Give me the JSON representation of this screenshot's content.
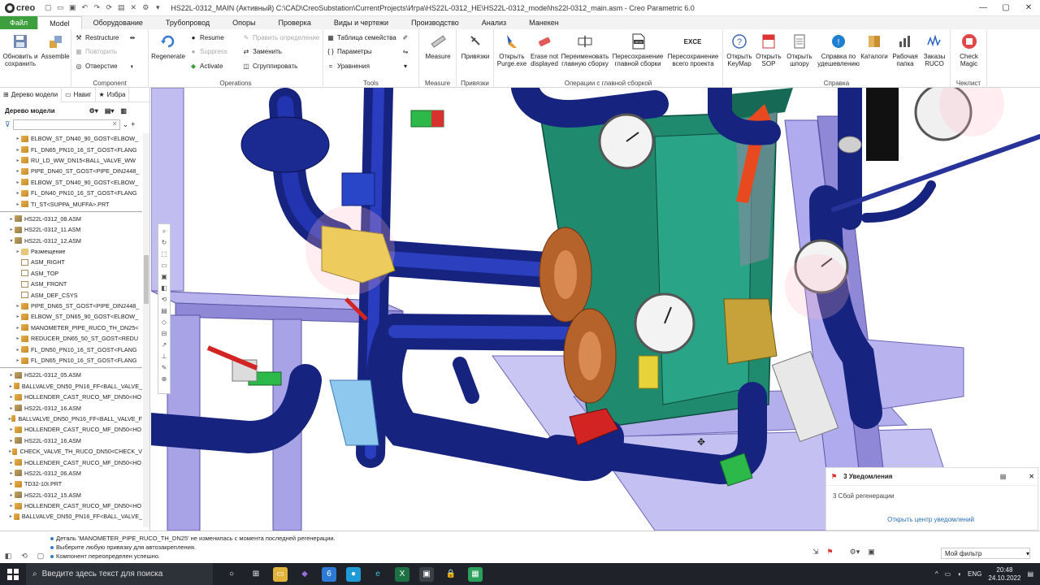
{
  "titlebar": {
    "app_logo": "creo",
    "title": "HS22L-0312_MAIN (Активный) C:\\CAD\\CreoSubstation\\CurrentProjects\\Игра\\HS22L-0312_HE\\HS22L-0312_model\\hs22l-0312_main.asm - Creo Parametric 6.0"
  },
  "menu": {
    "tabs": [
      "Файл",
      "Model",
      "Оборудование",
      "Трубопровод",
      "Опоры",
      "Проверка",
      "Виды и чертежи",
      "Производство",
      "Анализ",
      "Манекен"
    ],
    "active": "Model"
  },
  "ribbon": {
    "g1": {
      "btn1": "Обновить и сохранить",
      "btn2": "Assemble"
    },
    "component": {
      "label": "Component",
      "restructure": "Restructure",
      "repeat": "Повторить",
      "hole": "Отверстие"
    },
    "operations": {
      "label": "Operations",
      "regenerate": "Regenerate",
      "resume": "Resume",
      "suppress": "Suppress",
      "activate": "Activate",
      "edit_def": "Править определение",
      "replace": "Заменить",
      "group": "Сгруппировать"
    },
    "tools": {
      "label": "Tools",
      "family_table": "Таблица семейства",
      "parameters": "Параметры",
      "relations": "Уравнения"
    },
    "measure": {
      "label": "Measure",
      "btn": "Measure"
    },
    "snaps": {
      "label": "Привязки",
      "btn": "Привязки"
    },
    "main_asm_ops": {
      "label": "Операции с главной сборкой",
      "btns": [
        "Открыть Purge.exe",
        "Erase not displayed",
        "Переименовать главную сборку",
        "Пересохранение главной сборки",
        "Пересохранение всего проекта"
      ]
    },
    "help": {
      "label": "Справка",
      "btns": [
        "Открыть KeyMap",
        "Открыть SOP",
        "Открыть шпору",
        "Справка по удешевлению",
        "Каталоги",
        "Рабочая папка",
        "Заказы RUCO"
      ]
    },
    "checklist": {
      "label": "Чеклист",
      "btn": "Check Magic"
    }
  },
  "panel": {
    "tabs": [
      "Дерево модели",
      "Навиг",
      "Избра"
    ],
    "tree_title": "Дерево модели",
    "tree_items": [
      {
        "t": "ELBOW_ST_DN40_90_GOST<ELBOW_",
        "k": "part",
        "ind": 2
      },
      {
        "t": "FL_DN65_PN10_16_ST_GOST<FLANG",
        "k": "part",
        "ind": 2
      },
      {
        "t": "RU_LD_WW_DN15<BALL_VALVE_WW",
        "k": "part",
        "ind": 2
      },
      {
        "t": "PIPE_DN40_ST_GOST<PIPE_DIN2448_",
        "k": "part",
        "ind": 2
      },
      {
        "t": "ELBOW_ST_DN40_90_GOST<ELBOW_",
        "k": "part",
        "ind": 2
      },
      {
        "t": "FL_DN40_PN10_16_ST_GOST<FLANG",
        "k": "part",
        "ind": 2
      },
      {
        "t": "TI_ST<SUPPA_MUFFA>.PRT",
        "k": "part",
        "ind": 2
      },
      {
        "t": "HS22L-0312_08.ASM",
        "k": "asm",
        "ind": 1,
        "sep": true
      },
      {
        "t": "HS22L-0312_11.ASM",
        "k": "asm",
        "ind": 1
      },
      {
        "t": "HS22L-0312_12.ASM",
        "k": "asm",
        "ind": 1,
        "open": true
      },
      {
        "t": "Размещение",
        "k": "folder",
        "ind": 2
      },
      {
        "t": "ASM_RIGHT",
        "k": "datum",
        "ind": 2
      },
      {
        "t": "ASM_TOP",
        "k": "datum",
        "ind": 2
      },
      {
        "t": "ASM_FRONT",
        "k": "datum",
        "ind": 2
      },
      {
        "t": "ASM_DEF_CSYS",
        "k": "datum",
        "ind": 2
      },
      {
        "t": "PIPE_DN65_ST_GOST<PIPE_DIN2448_",
        "k": "part",
        "ind": 2
      },
      {
        "t": "ELBOW_ST_DN65_90_GOST<ELBOW_",
        "k": "part",
        "ind": 2
      },
      {
        "t": "MANOMETER_PIPE_RUCO_TH_DN25<",
        "k": "part",
        "ind": 2
      },
      {
        "t": "REDUCER_DN65_50_ST_GOST<REDU",
        "k": "part",
        "ind": 2
      },
      {
        "t": "FL_DN50_PN10_16_ST_GOST<FLANG",
        "k": "part",
        "ind": 2
      },
      {
        "t": "FL_DN65_PN10_16_ST_GOST<FLANG",
        "k": "part",
        "ind": 2
      },
      {
        "t": "HS22L-0312_05.ASM",
        "k": "asm",
        "ind": 1,
        "sep": true
      },
      {
        "t": "BALLVALVE_DN50_PN16_FF<BALL_VALVE_",
        "k": "part",
        "ind": 1
      },
      {
        "t": "HOLLENDER_CAST_RUCO_MF_DN50<HO",
        "k": "part",
        "ind": 1
      },
      {
        "t": "HS22L-0312_16.ASM",
        "k": "asm",
        "ind": 1
      },
      {
        "t": "BALLVALVE_DN50_PN16_FF<BALL_VALVE_F",
        "k": "part",
        "ind": 1
      },
      {
        "t": "HOLLENDER_CAST_RUCO_MF_DN50<HO",
        "k": "part",
        "ind": 1
      },
      {
        "t": "HS22L-0312_16.ASM",
        "k": "asm",
        "ind": 1
      },
      {
        "t": "CHECK_VALVE_TH_RUCO_DN50<CHECK_V",
        "k": "part",
        "ind": 1
      },
      {
        "t": "HOLLENDER_CAST_RUCO_MF_DN50<HO",
        "k": "part",
        "ind": 1
      },
      {
        "t": "HS22L-0312_06.ASM",
        "k": "asm",
        "ind": 1
      },
      {
        "t": "TD32-10I.PRT",
        "k": "part",
        "ind": 1
      },
      {
        "t": "HS22L-0312_15.ASM",
        "k": "asm",
        "ind": 1
      },
      {
        "t": "HOLLENDER_CAST_RUCO_MF_DN50<HO",
        "k": "part",
        "ind": 1
      },
      {
        "t": "BALLVALVE_DN50_PN16_FF<BALL_VALVE_",
        "k": "part",
        "ind": 1
      }
    ]
  },
  "notification": {
    "title": "3 Уведомления",
    "body": "3 Сбой регенерации",
    "link": "Открыть центр уведомлений"
  },
  "status": {
    "messages": [
      "Деталь 'MANOMETER_PIPE_RUCO_TH_DN25' не изменилась с момента последней регенерации.",
      "Выберите любую привязку для автозакрепления.",
      "Компонент переопределен успешно."
    ],
    "filter": "Мой фильтр"
  },
  "taskbar": {
    "search_placeholder": "Введите здесь текст для поиска",
    "lang": "ENG",
    "time": "20:48",
    "date": "24.10.2022"
  },
  "colors": {
    "file_tab": "#3c9e3c",
    "pipe_blue": "#1a2a8c",
    "frame_lilac": "#a9a3e6",
    "exchanger_green": "#1f8a6e",
    "valve_yellow": "#e8d23a",
    "flange_copper": "#b5622b"
  }
}
